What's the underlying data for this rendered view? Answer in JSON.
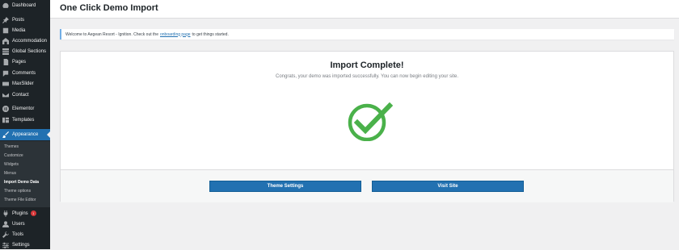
{
  "sidebar": {
    "items": [
      {
        "label": "Dashboard",
        "icon": "dashboard-icon"
      },
      {
        "label": "Posts",
        "icon": "pin-icon"
      },
      {
        "label": "Media",
        "icon": "media-icon"
      },
      {
        "label": "Accommodation",
        "icon": "building-icon"
      },
      {
        "label": "Global Sections",
        "icon": "sections-icon"
      },
      {
        "label": "Pages",
        "icon": "pages-icon"
      },
      {
        "label": "Comments",
        "icon": "comments-icon"
      },
      {
        "label": "MaxSlider",
        "icon": "slider-icon"
      },
      {
        "label": "Contact",
        "icon": "mail-icon"
      },
      {
        "label": "Elementor",
        "icon": "elementor-icon"
      },
      {
        "label": "Templates",
        "icon": "templates-icon"
      },
      {
        "label": "Appearance",
        "icon": "paintbrush-icon"
      },
      {
        "label": "Plugins",
        "icon": "plugin-icon",
        "badge": "1"
      },
      {
        "label": "Users",
        "icon": "users-icon"
      },
      {
        "label": "Tools",
        "icon": "wrench-icon"
      },
      {
        "label": "Settings",
        "icon": "settings-icon"
      }
    ],
    "submenu": [
      {
        "label": "Themes"
      },
      {
        "label": "Customize"
      },
      {
        "label": "Widgets"
      },
      {
        "label": "Menus"
      },
      {
        "label": "Import Demo Data"
      },
      {
        "label": "Theme options"
      },
      {
        "label": "Theme File Editor"
      }
    ]
  },
  "header": {
    "title": "One Click Demo Import"
  },
  "notice": {
    "before": "Welcome to Aegean Resort - Ignition. Check out the",
    "link": "onboarding page",
    "after": "to get things started."
  },
  "main": {
    "title": "Import Complete!",
    "subtitle": "Congrats, your demo was imported successfully. You can now begin editing your site.",
    "theme_settings_label": "Theme Settings",
    "visit_site_label": "Visit Site"
  },
  "colors": {
    "sidebar": "#1d2327",
    "accent": "#2271b1",
    "success": "#4ab14a"
  }
}
